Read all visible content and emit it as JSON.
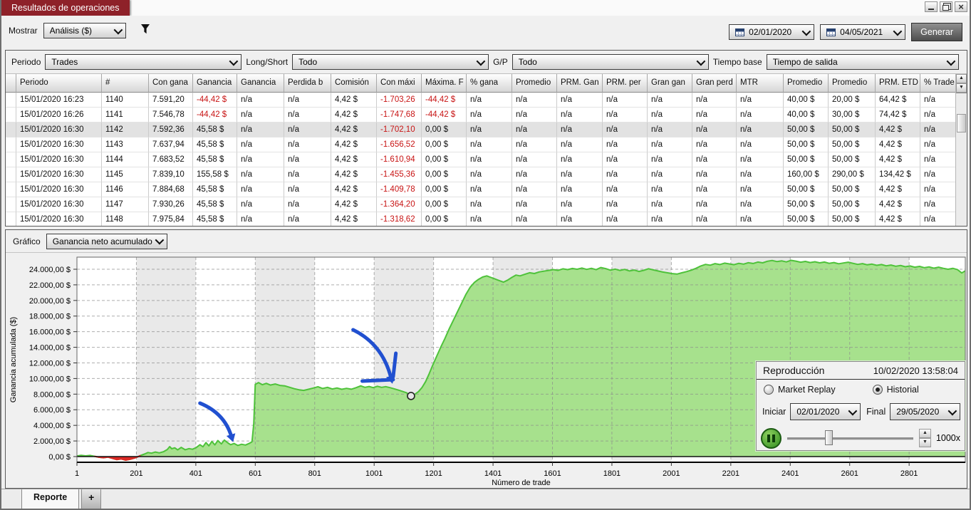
{
  "window": {
    "title": "Resultados de operaciones"
  },
  "toolbar": {
    "show_label": "Mostrar",
    "show_value": "Análisis ($)",
    "date_from": "02/01/2020",
    "date_to": "04/05/2021",
    "generate_label": "Generar"
  },
  "filters": {
    "period_label": "Periodo",
    "period_value": "Trades",
    "side_label": "Long/Short",
    "side_value": "Todo",
    "gp_label": "G/P",
    "gp_value": "Todo",
    "base_label": "Tiempo base",
    "base_value": "Tiempo de salida"
  },
  "table": {
    "headers": [
      "Periodo",
      "#",
      "Con gana",
      "Ganancia",
      "Ganancia",
      "Perdida b",
      "Comisión",
      "Con máxi",
      "Máxima. F",
      "% gana",
      "Promedio",
      "PRM. Gan",
      "PRM. per",
      "Gran gan",
      "Gran perd",
      "MTR",
      "Promedio",
      "Promedio",
      "PRM. ETD",
      "% Trade"
    ],
    "selected_row": 2,
    "rows": [
      [
        "15/01/2020 16:23",
        "1140",
        "7.591,20",
        "-44,42 $",
        "n/a",
        "n/a",
        "4,42 $",
        "-1.703,26",
        "-44,42 $",
        "n/a",
        "n/a",
        "n/a",
        "n/a",
        "n/a",
        "n/a",
        "n/a",
        "40,00 $",
        "20,00 $",
        "64,42 $",
        "n/a"
      ],
      [
        "15/01/2020 16:26",
        "1141",
        "7.546,78",
        "-44,42 $",
        "n/a",
        "n/a",
        "4,42 $",
        "-1.747,68",
        "-44,42 $",
        "n/a",
        "n/a",
        "n/a",
        "n/a",
        "n/a",
        "n/a",
        "n/a",
        "40,00 $",
        "30,00 $",
        "74,42 $",
        "n/a"
      ],
      [
        "15/01/2020 16:30",
        "1142",
        "7.592,36",
        "45,58 $",
        "n/a",
        "n/a",
        "4,42 $",
        "-1.702,10",
        "0,00 $",
        "n/a",
        "n/a",
        "n/a",
        "n/a",
        "n/a",
        "n/a",
        "n/a",
        "50,00 $",
        "50,00 $",
        "4,42 $",
        "n/a"
      ],
      [
        "15/01/2020 16:30",
        "1143",
        "7.637,94",
        "45,58 $",
        "n/a",
        "n/a",
        "4,42 $",
        "-1.656,52",
        "0,00 $",
        "n/a",
        "n/a",
        "n/a",
        "n/a",
        "n/a",
        "n/a",
        "n/a",
        "50,00 $",
        "50,00 $",
        "4,42 $",
        "n/a"
      ],
      [
        "15/01/2020 16:30",
        "1144",
        "7.683,52",
        "45,58 $",
        "n/a",
        "n/a",
        "4,42 $",
        "-1.610,94",
        "0,00 $",
        "n/a",
        "n/a",
        "n/a",
        "n/a",
        "n/a",
        "n/a",
        "n/a",
        "50,00 $",
        "50,00 $",
        "4,42 $",
        "n/a"
      ],
      [
        "15/01/2020 16:30",
        "1145",
        "7.839,10",
        "155,58 $",
        "n/a",
        "n/a",
        "4,42 $",
        "-1.455,36",
        "0,00 $",
        "n/a",
        "n/a",
        "n/a",
        "n/a",
        "n/a",
        "n/a",
        "n/a",
        "160,00 $",
        "290,00 $",
        "134,42 $",
        "n/a"
      ],
      [
        "15/01/2020 16:30",
        "1146",
        "7.884,68",
        "45,58 $",
        "n/a",
        "n/a",
        "4,42 $",
        "-1.409,78",
        "0,00 $",
        "n/a",
        "n/a",
        "n/a",
        "n/a",
        "n/a",
        "n/a",
        "n/a",
        "50,00 $",
        "50,00 $",
        "4,42 $",
        "n/a"
      ],
      [
        "15/01/2020 16:30",
        "1147",
        "7.930,26",
        "45,58 $",
        "n/a",
        "n/a",
        "4,42 $",
        "-1.364,20",
        "0,00 $",
        "n/a",
        "n/a",
        "n/a",
        "n/a",
        "n/a",
        "n/a",
        "n/a",
        "50,00 $",
        "50,00 $",
        "4,42 $",
        "n/a"
      ],
      [
        "15/01/2020 16:30",
        "1148",
        "7.975,84",
        "45,58 $",
        "n/a",
        "n/a",
        "4,42 $",
        "-1.318,62",
        "0,00 $",
        "n/a",
        "n/a",
        "n/a",
        "n/a",
        "n/a",
        "n/a",
        "n/a",
        "50,00 $",
        "50,00 $",
        "4,42 $",
        "n/a"
      ]
    ]
  },
  "chart": {
    "selector_label": "Gráfico",
    "selector_value": "Ganancia neto acumulado"
  },
  "chart_data": {
    "type": "area",
    "title": "",
    "xlabel": "Número de trade",
    "ylabel": "Ganancia acumulada ($)",
    "xlim": [
      1,
      2990
    ],
    "ylim": [
      -730,
      25550
    ],
    "grid": true,
    "band_interval": 200,
    "x_ticks": [
      1,
      201,
      401,
      601,
      801,
      1001,
      1201,
      1401,
      1601,
      1801,
      2001,
      2201,
      2401,
      2601,
      2801
    ],
    "y_ticks": [
      0,
      2000,
      4000,
      6000,
      8000,
      10000,
      12000,
      14000,
      16000,
      18000,
      20000,
      22000,
      24000
    ],
    "y_tick_labels": [
      "0,00 $",
      "2.000,00 $",
      "4.000,00 $",
      "6.000,00 $",
      "8.000,00 $",
      "10.000,00 $",
      "12.000,00 $",
      "14.000,00 $",
      "16.000,00 $",
      "18.000,00 $",
      "20.000,00 $",
      "22.000,00 $",
      "24.000,00 $"
    ],
    "series": [
      {
        "name": "Ganancia neto acumulado",
        "color": "#4ec23a",
        "fill": "#a7e18d",
        "negative_color": "#e02525",
        "points": [
          [
            1,
            80
          ],
          [
            15,
            160
          ],
          [
            30,
            90
          ],
          [
            45,
            150
          ],
          [
            60,
            40
          ],
          [
            75,
            -80
          ],
          [
            90,
            -150
          ],
          [
            105,
            -60
          ],
          [
            120,
            -220
          ],
          [
            135,
            -380
          ],
          [
            150,
            -300
          ],
          [
            165,
            -460
          ],
          [
            180,
            -350
          ],
          [
            195,
            -180
          ],
          [
            205,
            -40
          ],
          [
            215,
            140
          ],
          [
            228,
            320
          ],
          [
            240,
            520
          ],
          [
            252,
            440
          ],
          [
            265,
            580
          ],
          [
            278,
            470
          ],
          [
            292,
            620
          ],
          [
            305,
            900
          ],
          [
            313,
            1280
          ],
          [
            320,
            1000
          ],
          [
            330,
            1120
          ],
          [
            340,
            860
          ],
          [
            352,
            1180
          ],
          [
            365,
            880
          ],
          [
            378,
            1020
          ],
          [
            390,
            940
          ],
          [
            402,
            1150
          ],
          [
            415,
            1520
          ],
          [
            425,
            1260
          ],
          [
            435,
            1800
          ],
          [
            445,
            1380
          ],
          [
            455,
            1940
          ],
          [
            465,
            1500
          ],
          [
            475,
            2050
          ],
          [
            487,
            1620
          ],
          [
            497,
            2120
          ],
          [
            508,
            1780
          ],
          [
            518,
            1520
          ],
          [
            530,
            1680
          ],
          [
            542,
            1420
          ],
          [
            555,
            1580
          ],
          [
            568,
            1480
          ],
          [
            580,
            1680
          ],
          [
            590,
            1900
          ],
          [
            596,
            4200
          ],
          [
            601,
            9250
          ],
          [
            612,
            9480
          ],
          [
            625,
            9210
          ],
          [
            638,
            9380
          ],
          [
            652,
            9160
          ],
          [
            668,
            9300
          ],
          [
            684,
            9120
          ],
          [
            700,
            9060
          ],
          [
            716,
            8880
          ],
          [
            732,
            8700
          ],
          [
            748,
            8560
          ],
          [
            764,
            8480
          ],
          [
            780,
            8620
          ],
          [
            796,
            8780
          ],
          [
            812,
            8950
          ],
          [
            828,
            8720
          ],
          [
            844,
            8870
          ],
          [
            860,
            8660
          ],
          [
            876,
            8790
          ],
          [
            892,
            8620
          ],
          [
            908,
            8740
          ],
          [
            924,
            8630
          ],
          [
            940,
            8820
          ],
          [
            956,
            9060
          ],
          [
            970,
            8870
          ],
          [
            984,
            8980
          ],
          [
            998,
            8830
          ],
          [
            1012,
            9010
          ],
          [
            1026,
            8870
          ],
          [
            1040,
            8960
          ],
          [
            1054,
            8830
          ],
          [
            1068,
            8690
          ],
          [
            1082,
            8520
          ],
          [
            1096,
            8360
          ],
          [
            1110,
            8180
          ],
          [
            1125,
            7760
          ],
          [
            1138,
            7980
          ],
          [
            1150,
            8320
          ],
          [
            1162,
            8850
          ],
          [
            1174,
            9600
          ],
          [
            1186,
            10600
          ],
          [
            1198,
            11700
          ],
          [
            1212,
            12900
          ],
          [
            1226,
            14100
          ],
          [
            1240,
            15200
          ],
          [
            1254,
            16400
          ],
          [
            1268,
            17500
          ],
          [
            1282,
            18600
          ],
          [
            1296,
            19700
          ],
          [
            1310,
            20800
          ],
          [
            1324,
            21700
          ],
          [
            1338,
            22300
          ],
          [
            1352,
            22700
          ],
          [
            1366,
            23000
          ],
          [
            1380,
            23150
          ],
          [
            1394,
            22950
          ],
          [
            1408,
            22750
          ],
          [
            1422,
            22550
          ],
          [
            1436,
            22350
          ],
          [
            1450,
            22600
          ],
          [
            1464,
            22950
          ],
          [
            1478,
            23250
          ],
          [
            1492,
            23150
          ],
          [
            1508,
            23350
          ],
          [
            1524,
            23550
          ],
          [
            1540,
            23450
          ],
          [
            1556,
            23650
          ],
          [
            1572,
            23750
          ],
          [
            1588,
            23850
          ],
          [
            1604,
            23950
          ],
          [
            1620,
            23850
          ],
          [
            1636,
            24050
          ],
          [
            1652,
            23950
          ],
          [
            1668,
            24100
          ],
          [
            1684,
            24000
          ],
          [
            1700,
            24150
          ],
          [
            1716,
            23980
          ],
          [
            1732,
            24120
          ],
          [
            1748,
            23940
          ],
          [
            1764,
            24220
          ],
          [
            1780,
            24080
          ],
          [
            1796,
            23880
          ],
          [
            1812,
            24020
          ],
          [
            1828,
            23840
          ],
          [
            1844,
            23980
          ],
          [
            1860,
            23780
          ],
          [
            1876,
            23900
          ],
          [
            1892,
            23720
          ],
          [
            1908,
            23860
          ],
          [
            1924,
            24060
          ],
          [
            1940,
            23920
          ],
          [
            1956,
            23780
          ],
          [
            1972,
            23640
          ],
          [
            1988,
            23540
          ],
          [
            2004,
            23440
          ],
          [
            2020,
            23380
          ],
          [
            2036,
            23540
          ],
          [
            2052,
            23700
          ],
          [
            2068,
            23880
          ],
          [
            2084,
            24120
          ],
          [
            2100,
            24420
          ],
          [
            2116,
            24620
          ],
          [
            2132,
            24520
          ],
          [
            2148,
            24720
          ],
          [
            2164,
            24600
          ],
          [
            2180,
            24780
          ],
          [
            2196,
            24680
          ],
          [
            2212,
            24580
          ],
          [
            2228,
            24760
          ],
          [
            2244,
            24660
          ],
          [
            2260,
            24840
          ],
          [
            2276,
            24740
          ],
          [
            2292,
            24920
          ],
          [
            2308,
            24820
          ],
          [
            2324,
            25020
          ],
          [
            2340,
            25120
          ],
          [
            2356,
            24980
          ],
          [
            2372,
            25080
          ],
          [
            2388,
            24940
          ],
          [
            2404,
            25140
          ],
          [
            2420,
            25040
          ],
          [
            2436,
            24900
          ],
          [
            2452,
            25000
          ],
          [
            2468,
            24860
          ],
          [
            2484,
            24960
          ],
          [
            2500,
            24820
          ],
          [
            2516,
            24920
          ],
          [
            2532,
            24760
          ],
          [
            2548,
            24860
          ],
          [
            2564,
            24700
          ],
          [
            2580,
            24800
          ],
          [
            2596,
            24900
          ],
          [
            2612,
            24760
          ],
          [
            2628,
            24620
          ],
          [
            2644,
            24720
          ],
          [
            2660,
            24560
          ],
          [
            2676,
            24660
          ],
          [
            2692,
            24500
          ],
          [
            2708,
            24600
          ],
          [
            2724,
            24440
          ],
          [
            2740,
            24540
          ],
          [
            2756,
            24380
          ],
          [
            2772,
            24480
          ],
          [
            2788,
            24320
          ],
          [
            2804,
            24420
          ],
          [
            2820,
            24260
          ],
          [
            2836,
            24360
          ],
          [
            2852,
            24200
          ],
          [
            2868,
            24300
          ],
          [
            2884,
            24140
          ],
          [
            2900,
            24260
          ],
          [
            2916,
            24120
          ],
          [
            2932,
            24000
          ],
          [
            2948,
            24120
          ],
          [
            2964,
            23940
          ],
          [
            2978,
            23520
          ],
          [
            2990,
            23800
          ]
        ]
      }
    ],
    "marker": {
      "x": 1125,
      "y": 7760
    },
    "annotations": [
      {
        "type": "arrow",
        "color": "#2150d0",
        "from": [
          415,
          6845
        ],
        "to": [
          521,
          2555
        ]
      },
      {
        "type": "arrow",
        "color": "#2150d0",
        "from": [
          930,
          16240
        ],
        "to": [
          1058,
          10040
        ],
        "strokes": [
          [
            [
              961,
              9670
            ],
            [
              1065,
              9855
            ]
          ],
          [
            [
              1074,
              13230
            ],
            [
              1065,
              10220
            ]
          ]
        ]
      }
    ]
  },
  "playback": {
    "title": "Reproducción",
    "timestamp": "10/02/2020 13:58:04",
    "option_market": "Market Replay",
    "option_historical": "Historial",
    "selected_option": "Historial",
    "start_label": "Iniciar",
    "start_value": "02/01/2020",
    "end_label": "Final",
    "end_value": "29/05/2020",
    "speed": "1000x"
  },
  "tabs": {
    "report": "Reporte",
    "add": "+"
  },
  "colors": {
    "title_bg": "#8e2129",
    "negative_text": "#c81414",
    "selected_row": "#e2e2e2"
  }
}
